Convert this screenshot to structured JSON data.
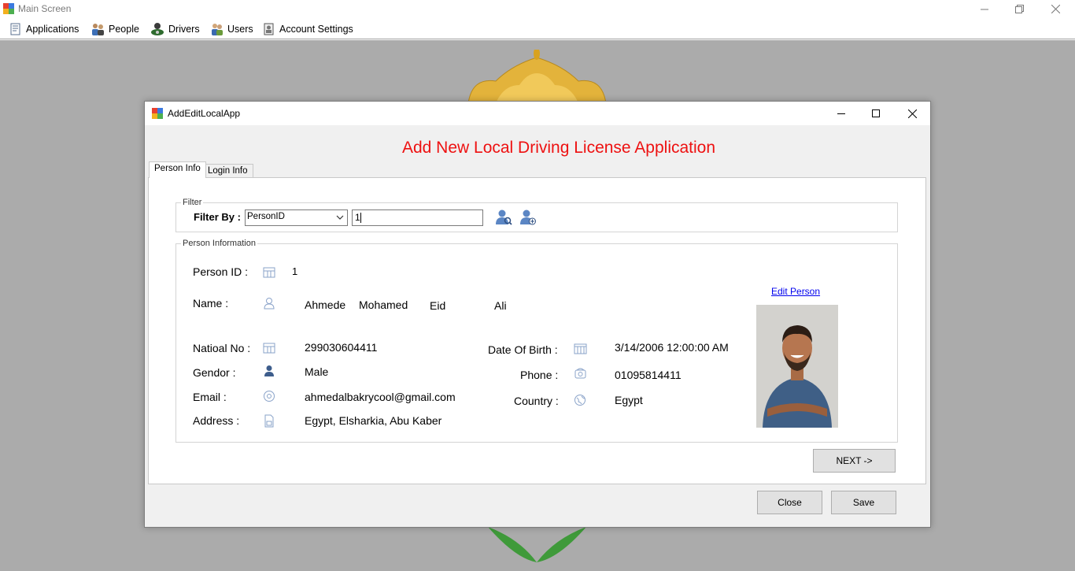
{
  "main_window": {
    "title": "Main Screen",
    "menu": [
      {
        "label": "Applications",
        "icon": "applications-icon"
      },
      {
        "label": "People",
        "icon": "people-icon"
      },
      {
        "label": "Drivers",
        "icon": "drivers-icon"
      },
      {
        "label": "Users",
        "icon": "users-icon"
      },
      {
        "label": "Account Settings",
        "icon": "account-settings-icon"
      }
    ]
  },
  "dialog": {
    "title": "AddEditLocalApp",
    "heading": "Add New Local Driving License Application",
    "tabs": [
      "Person Info",
      "Login Info"
    ],
    "filter": {
      "caption": "Filter",
      "label": "Filter By :",
      "selected": "PersonID",
      "value": "1"
    },
    "person_info": {
      "caption": "Person Information",
      "person_id_label": "Person ID :",
      "person_id": "1",
      "name_label": "Name :",
      "first_name": "Ahmede",
      "second_name": "Mohamed",
      "third_name": "Eid",
      "last_name": "Ali",
      "national_no_label": "Natioal No :",
      "national_no": "299030604411",
      "gender_label": "Gendor :",
      "gender": "Male",
      "email_label": "Email :",
      "email": "ahmedalbakrycool@gmail.com",
      "address_label": "Address :",
      "address": "Egypt,  Elsharkia,  Abu Kaber",
      "dob_label": "Date Of Birth :",
      "dob": "3/14/2006 12:00:00 AM",
      "phone_label": "Phone :",
      "phone": "01095814411",
      "country_label": "Country :",
      "country": "Egypt",
      "edit_link": "Edit Person"
    },
    "next_button": "NEXT  ->",
    "close_button": "Close",
    "save_button": "Save"
  },
  "colors": {
    "heading": "#ee1111",
    "link": "#0000ee",
    "desktop": "#ababab"
  }
}
